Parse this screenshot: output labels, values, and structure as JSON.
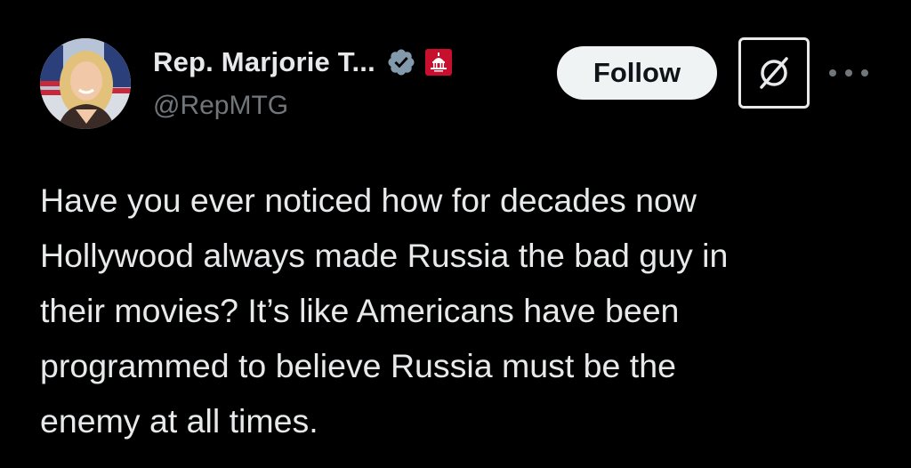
{
  "author": {
    "display_name": "Rep. Marjorie T...",
    "handle": "@RepMTG",
    "avatar_icon": "profile-photo",
    "verified_icon": "verified-badge-icon",
    "verified_color": "#829aab",
    "affiliation_icon": "us-capitol-icon",
    "affiliation_color": "#c8102e"
  },
  "actions": {
    "follow_label": "Follow",
    "grok_icon": "grok-icon",
    "more_icon": "more-options-icon"
  },
  "tweet": {
    "text": "Have you ever noticed how for decades now\nHollywood always made Russia the bad guy in\ntheir movies?  It’s like Americans have been\nprogrammed to believe Russia must be the\nenemy at all times."
  },
  "colors": {
    "background": "#000000",
    "primary_text": "#e7e9ea",
    "secondary_text": "#71767b",
    "follow_bg": "#eff3f4",
    "follow_text": "#0f1419"
  }
}
